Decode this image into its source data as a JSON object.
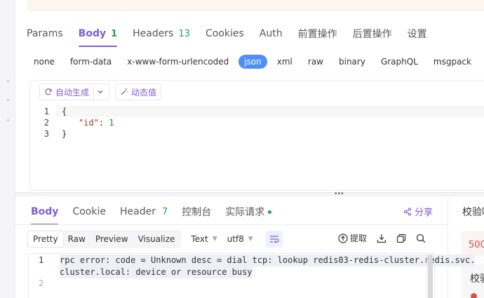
{
  "request_tabs": [
    {
      "label": "Params",
      "count": ""
    },
    {
      "label": "Body",
      "count": "1"
    },
    {
      "label": "Headers",
      "count": "13"
    },
    {
      "label": "Cookies",
      "count": ""
    },
    {
      "label": "Auth",
      "count": ""
    },
    {
      "label": "前置操作",
      "count": ""
    },
    {
      "label": "后置操作",
      "count": ""
    },
    {
      "label": "设置",
      "count": ""
    }
  ],
  "active_request_tab": "Body",
  "body_types": [
    "none",
    "form-data",
    "x-www-form-urlencoded",
    "json",
    "xml",
    "raw",
    "binary",
    "GraphQL",
    "msgpack"
  ],
  "active_body_type": "json",
  "editor_toolbar": {
    "auto_generate_label": "自动生成",
    "dynamic_value_label": "动态值"
  },
  "request_body_lines": [
    {
      "num": "1",
      "text": "{"
    },
    {
      "num": "2",
      "key": "\"id\"",
      "sep": ": ",
      "value": "1"
    },
    {
      "num": "3",
      "text": "}"
    }
  ],
  "response_tabs": [
    {
      "label": "Body",
      "count": ""
    },
    {
      "label": "Cookie",
      "count": ""
    },
    {
      "label": "Header",
      "count": "7"
    },
    {
      "label": "控制台",
      "count": ""
    },
    {
      "label": "实际请求",
      "count": ""
    }
  ],
  "active_response_tab": "Body",
  "share_label": "分享",
  "format_buttons": [
    "Pretty",
    "Raw",
    "Preview",
    "Visualize"
  ],
  "active_format": "Pretty",
  "format_select": "Text",
  "encoding_select": "utf8",
  "extract_label": "提取",
  "response_lines": [
    {
      "num": "1",
      "text": "rpc error: code = Unknown desc = dial tcp: lookup redis03-redis-cluster.redis.svc."
    },
    {
      "num": "",
      "text": "cluster.local: device or resource busy"
    },
    {
      "num": "2",
      "text": ""
    }
  ],
  "right_panel": {
    "title": "校验响",
    "status": "500",
    "subtitle": "校验"
  },
  "colors": {
    "accent": "#7b5fd6",
    "active_pill": "#4d8ff7",
    "count_green": "#1fa060",
    "error_red": "#e04b4b"
  }
}
